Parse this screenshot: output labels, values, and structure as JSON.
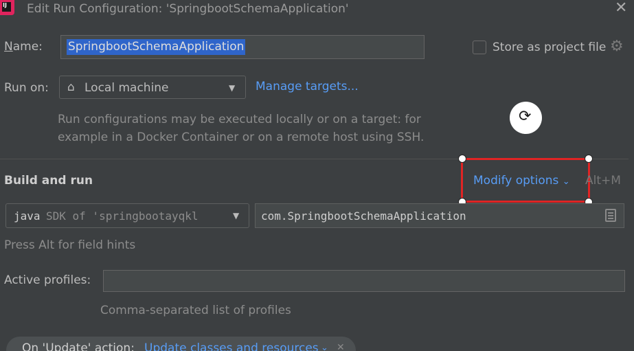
{
  "window": {
    "title": "Edit Run Configuration: 'SpringbootSchemaApplication'",
    "app_icon_text": "IJ"
  },
  "name": {
    "label": "Name:",
    "value": "SpringbootSchemaApplication"
  },
  "store": {
    "label": "Store as project file",
    "checked": false
  },
  "run_on": {
    "label": "Run on:",
    "selected": "Local machine",
    "manage_link": "Manage targets...",
    "hint_line1": "Run configurations may be executed locally or on a target: for",
    "hint_line2": "example in a Docker Container or on a remote host using SSH."
  },
  "build": {
    "section_title": "Build and run",
    "modify_options": "Modify options",
    "shortcut": "Alt+M",
    "sdk_java": "java",
    "sdk_desc": "SDK of 'springbootayqkl",
    "main_class": "com.SpringbootSchemaApplication",
    "field_hint": "Press Alt for field hints"
  },
  "profiles": {
    "label": "Active profiles:",
    "value": "",
    "hint": "Comma-separated list of profiles"
  },
  "update_action": {
    "label": "On 'Update' action:",
    "value": "Update classes and resources"
  },
  "colors": {
    "background": "#3c3f41",
    "link": "#589df6",
    "selection": "#2f65ca",
    "highlight_border": "#e02424"
  },
  "icons": [
    "app-logo-icon",
    "close-icon",
    "gear-icon",
    "home-icon",
    "chevron-down-icon",
    "refresh-icon",
    "document-icon"
  ]
}
